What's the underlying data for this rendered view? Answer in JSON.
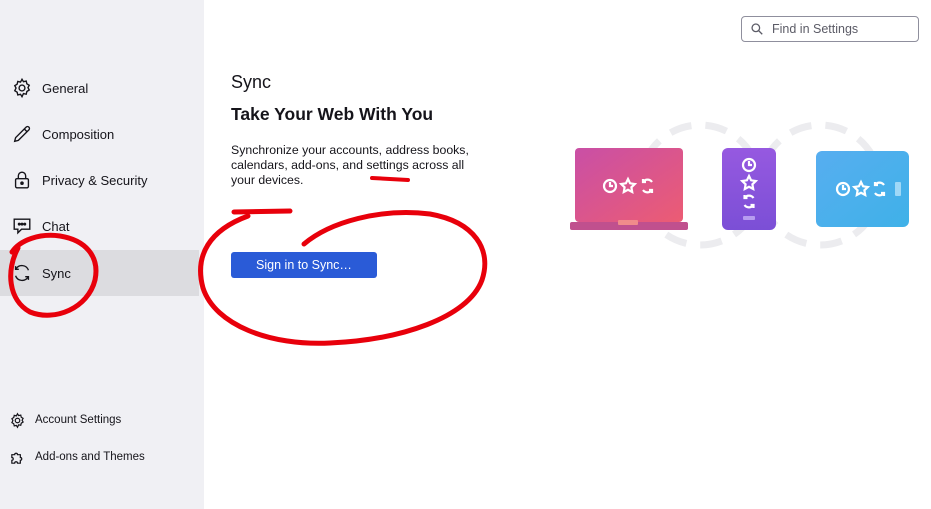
{
  "search": {
    "placeholder": "Find in Settings"
  },
  "sidebar": {
    "items": [
      {
        "label": "General",
        "icon": "gear-icon"
      },
      {
        "label": "Composition",
        "icon": "pencil-icon"
      },
      {
        "label": "Privacy & Security",
        "icon": "lock-icon"
      },
      {
        "label": "Chat",
        "icon": "chat-icon"
      },
      {
        "label": "Sync",
        "icon": "sync-icon",
        "selected": true
      }
    ],
    "footer": [
      {
        "label": "Account Settings",
        "icon": "gear-icon"
      },
      {
        "label": "Add-ons and Themes",
        "icon": "puzzle-icon"
      }
    ]
  },
  "main": {
    "section_title": "Sync",
    "heading": "Take Your Web With You",
    "description": "Synchronize your accounts, address books, calendars, add-ons, and settings across all your devices.",
    "sign_in_button": "Sign in to Sync…"
  },
  "colors": {
    "accent": "#2a5bd7",
    "sidebar_bg": "#f0f0f4",
    "selected_bg": "#dcdce0",
    "annotation_red": "#e8000b"
  }
}
